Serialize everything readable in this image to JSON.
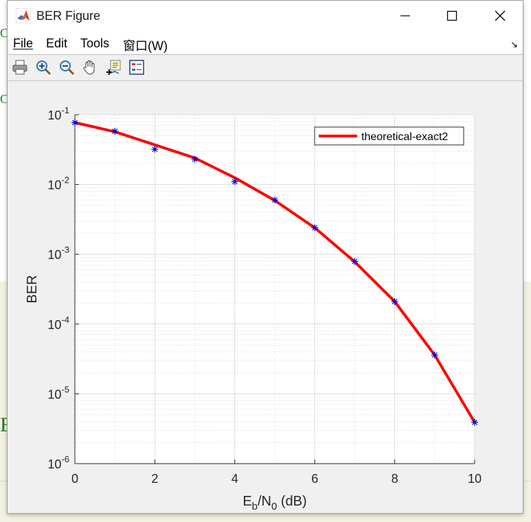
{
  "window": {
    "title": "BER Figure"
  },
  "menu": {
    "file": "File",
    "edit": "Edit",
    "tools": "Tools",
    "window": "窗口(W)"
  },
  "toolbar": {
    "icons": [
      "print-icon",
      "zoom-in-icon",
      "zoom-out-icon",
      "pan-hand-icon",
      "data-cursor-icon",
      "legend-icon"
    ]
  },
  "background": {
    "glyph_small": "C",
    "glyph_large": "E"
  },
  "chart_data": {
    "type": "line",
    "xlabel_main": "E",
    "xlabel_sub1": "b",
    "xlabel_mid": "/N",
    "xlabel_sub2": "0",
    "xlabel_tail": " (dB)",
    "ylabel": "BER",
    "xlim": [
      0,
      10
    ],
    "ylim": [
      1e-06,
      0.1
    ],
    "yscale": "log",
    "grid": true,
    "legend_position": "top-right",
    "x_ticks": [
      0,
      2,
      4,
      6,
      8,
      10
    ],
    "y_tick_exponents": [
      -1,
      -2,
      -3,
      -4,
      -5,
      -6
    ],
    "series": [
      {
        "name": "theoretical-exact2",
        "color": "#ff0000",
        "style": "line",
        "x": [
          0,
          1,
          2,
          3,
          4,
          5,
          6,
          7,
          8,
          9,
          10
        ],
        "y": [
          0.077,
          0.057,
          0.037,
          0.024,
          0.0125,
          0.0059,
          0.0024,
          0.00078,
          0.00021,
          3.6e-05,
          3.9e-06
        ]
      },
      {
        "color": "#0000cc",
        "style": "marker-asterisk",
        "x": [
          0,
          1,
          2,
          3,
          4,
          5,
          6,
          7,
          8,
          9,
          10
        ],
        "y": [
          0.077,
          0.058,
          0.032,
          0.023,
          0.011,
          0.006,
          0.0024,
          0.00079,
          0.00021,
          3.6e-05,
          3.9e-06
        ]
      }
    ]
  }
}
